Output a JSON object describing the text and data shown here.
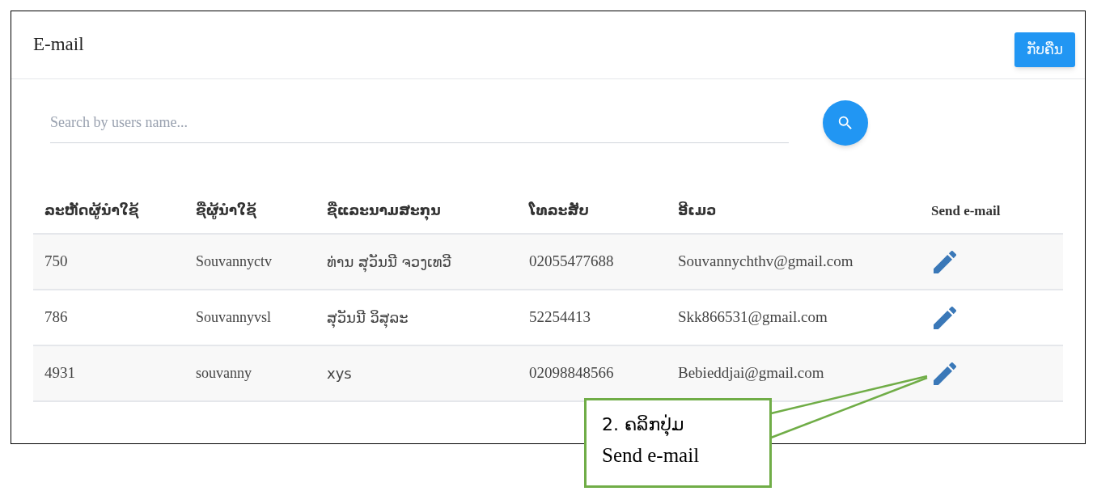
{
  "header": {
    "title": "E-mail",
    "back_button": "ກັບຄືນ"
  },
  "search": {
    "placeholder": "Search by users name..."
  },
  "table": {
    "columns": [
      "ລະຫັດຜູ້ນຳໃຊ້",
      "ຊື່ຜູ້ນຳໃຊ້",
      "ຊື່ແລະນາມສະກຸນ",
      "ໂທລະສັບ",
      "ອີເມວ",
      "Send e-mail"
    ],
    "rows": [
      {
        "cells": [
          "750",
          "Souvannyctv",
          "ທ່ານ ສຸວັນນີ ຈວງເທວີ",
          "02055477688",
          "Souvannychthv@gmail.com"
        ]
      },
      {
        "cells": [
          "786",
          "Souvannyvsl",
          "ສຸວັນນີ ວິສຸລະ",
          "52254413",
          "Skk866531@gmail.com"
        ]
      },
      {
        "cells": [
          "4931",
          "souvanny",
          "xys",
          "02098848566",
          "Bebieddjai@gmail.com"
        ]
      }
    ]
  },
  "callout": {
    "lines": [
      "2. ຄລິກປຸ່ມ",
      "Send e-mail"
    ]
  }
}
